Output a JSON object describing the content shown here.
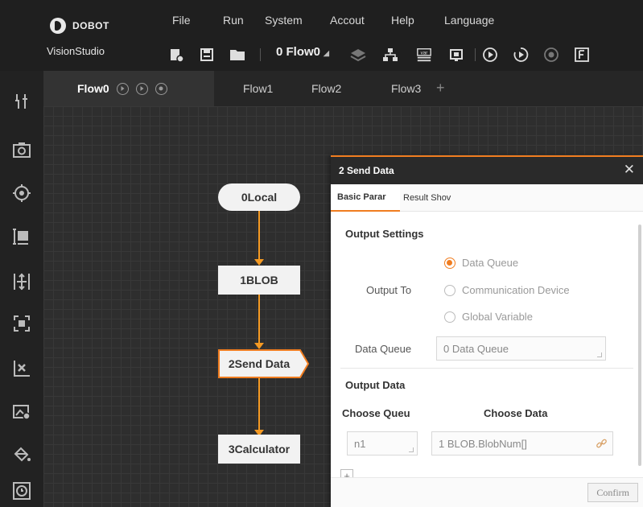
{
  "app": {
    "brand": "DOBOT",
    "product": "VisionStudio"
  },
  "menu": [
    "File",
    "Run",
    "System",
    "Accout",
    "Help",
    "Language"
  ],
  "toolbar": {
    "flow_selector": "0 Flow0",
    "icons": [
      "new-file-icon",
      "save-icon",
      "open-folder-icon",
      "layers-icon",
      "network-icon",
      "variable-icon",
      "camera-device-icon",
      "run-once-icon",
      "run-loop-icon",
      "stop-icon",
      "f-icon"
    ]
  },
  "sidebar": {
    "icons": [
      "tools-icon",
      "camera-icon",
      "target-icon",
      "measure-icon",
      "align-icon",
      "focus-frame-icon",
      "scatter-icon",
      "image-settings-icon",
      "fill-icon",
      "history-icon"
    ]
  },
  "tabs": [
    "Flow0",
    "Flow1",
    "Flow2",
    "Flow3"
  ],
  "flow": {
    "nodes": [
      "0Local",
      "1BLOB",
      "2Send Data",
      "3Calculator"
    ]
  },
  "dialog": {
    "title": "2 Send Data",
    "tabs": [
      "Basic Parar",
      "Result Shov"
    ],
    "output_settings": {
      "heading": "Output Settings",
      "output_to_label": "Output To",
      "options": [
        "Data Queue",
        "Communication Device",
        "Global Variable"
      ],
      "selected": "Data Queue",
      "data_queue_label": "Data Queue",
      "data_queue_value": "0 Data Queue"
    },
    "output_data": {
      "heading": "Output Data",
      "col_queue": "Choose Queu",
      "col_data": "Choose Data",
      "rows": [
        {
          "queue": "n1",
          "data": "1 BLOB.BlobNum[]"
        }
      ]
    },
    "confirm_label": "Confirm"
  },
  "colors": {
    "accent": "#f07d20",
    "connector": "#f59a23"
  }
}
